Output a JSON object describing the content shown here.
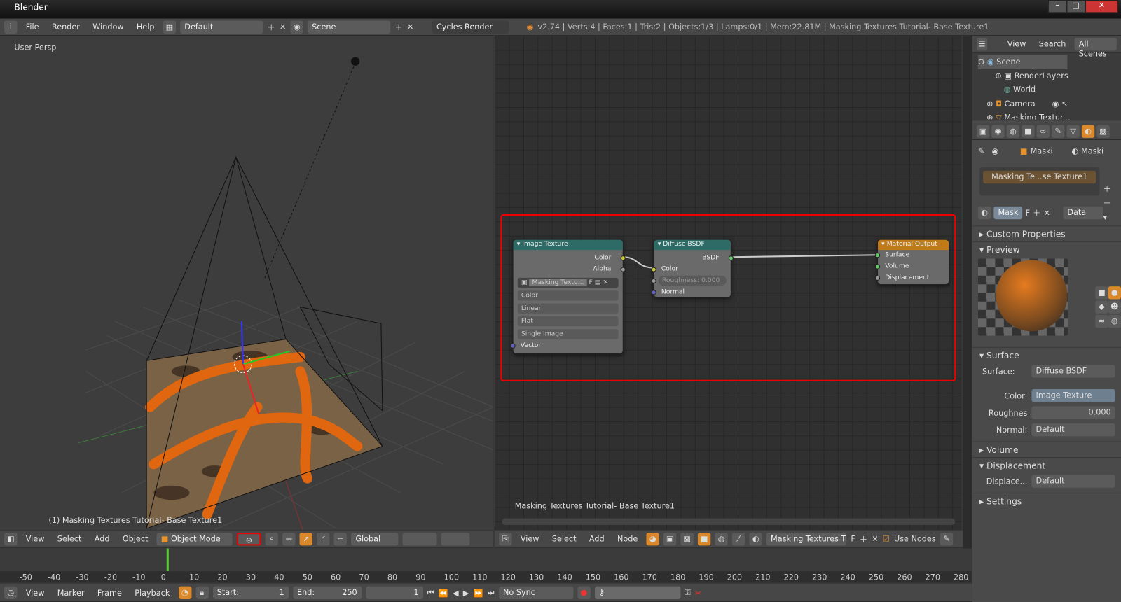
{
  "app": {
    "title": "Blender"
  },
  "info_header": {
    "menus": [
      "File",
      "Render",
      "Window",
      "Help"
    ],
    "layout": "Default",
    "scene": "Scene",
    "engine": "Cycles Render",
    "stats": "v2.74 | Verts:4 | Faces:1 | Tris:2 | Objects:1/3 | Lamps:0/1 | Mem:22.81M | Masking Textures Tutorial- Base Texture1"
  },
  "viewport": {
    "label": "User Persp",
    "object_label": "(1) Masking Textures Tutorial- Base Texture1",
    "header": {
      "menus": [
        "View",
        "Select",
        "Add",
        "Object"
      ],
      "mode": "Object Mode",
      "orientation": "Global"
    }
  },
  "node_editor": {
    "object_label": "Masking Textures Tutorial- Base Texture1",
    "header": {
      "menus": [
        "View",
        "Select",
        "Add",
        "Node"
      ],
      "material": "Masking Textures T...",
      "fake": "F",
      "use_nodes": "Use Nodes",
      "use_nodes_checked": true
    },
    "nodes": {
      "image_texture": {
        "title": "Image Texture",
        "outputs": [
          "Color",
          "Alpha"
        ],
        "image": "Masking Textu...",
        "fake": "F",
        "color_space": "Color",
        "interpolation": "Linear",
        "projection": "Flat",
        "source": "Single Image",
        "input": "Vector"
      },
      "diffuse": {
        "title": "Diffuse BSDF",
        "output": "BSDF",
        "color": "Color",
        "roughness": "Roughness:",
        "roughness_value": "0.000",
        "normal": "Normal"
      },
      "output": {
        "title": "Material Output",
        "inputs": [
          "Surface",
          "Volume",
          "Displacement"
        ]
      }
    }
  },
  "outliner": {
    "menus": [
      "View",
      "Search"
    ],
    "filter": "All Scenes",
    "items": [
      "Scene",
      "RenderLayers",
      "World",
      "Camera",
      "Masking Textur..."
    ]
  },
  "properties": {
    "breadcrumb": [
      "Maski",
      "Maski"
    ],
    "material_slot": "Masking Te...se Texture1",
    "material_name": "Mask",
    "fake": "F",
    "link": "Data",
    "panels": {
      "custom": "Custom Properties",
      "preview": "Preview",
      "surface": "Surface",
      "volume": "Volume",
      "displacement": "Displacement",
      "settings": "Settings"
    },
    "surface": {
      "surface_label": "Surface:",
      "surface_value": "Diffuse BSDF",
      "color_label": "Color:",
      "color_value": "Image Texture",
      "rough_label": "Roughnes",
      "rough_value": "0.000",
      "normal_label": "Normal:",
      "normal_value": "Default"
    },
    "displacement": {
      "label": "Displace...",
      "value": "Default"
    }
  },
  "timeline": {
    "ticks": [
      "-50",
      "-40",
      "-30",
      "-20",
      "-10",
      "0",
      "10",
      "20",
      "30",
      "40",
      "50",
      "60",
      "70",
      "80",
      "90",
      "100",
      "110",
      "120",
      "130",
      "140",
      "150",
      "160",
      "170",
      "180",
      "190",
      "200",
      "210",
      "220",
      "230",
      "240",
      "250",
      "260",
      "270",
      "280"
    ],
    "menus": [
      "View",
      "Marker",
      "Frame",
      "Playback"
    ],
    "start": "Start:",
    "start_value": "1",
    "end": "End:",
    "end_value": "250",
    "current": "1",
    "sync": "No Sync"
  },
  "colors": {
    "accent": "#d9892c",
    "highlight": "#e00000",
    "node_shader": "#2f6b66",
    "node_output": "#c07a17"
  }
}
